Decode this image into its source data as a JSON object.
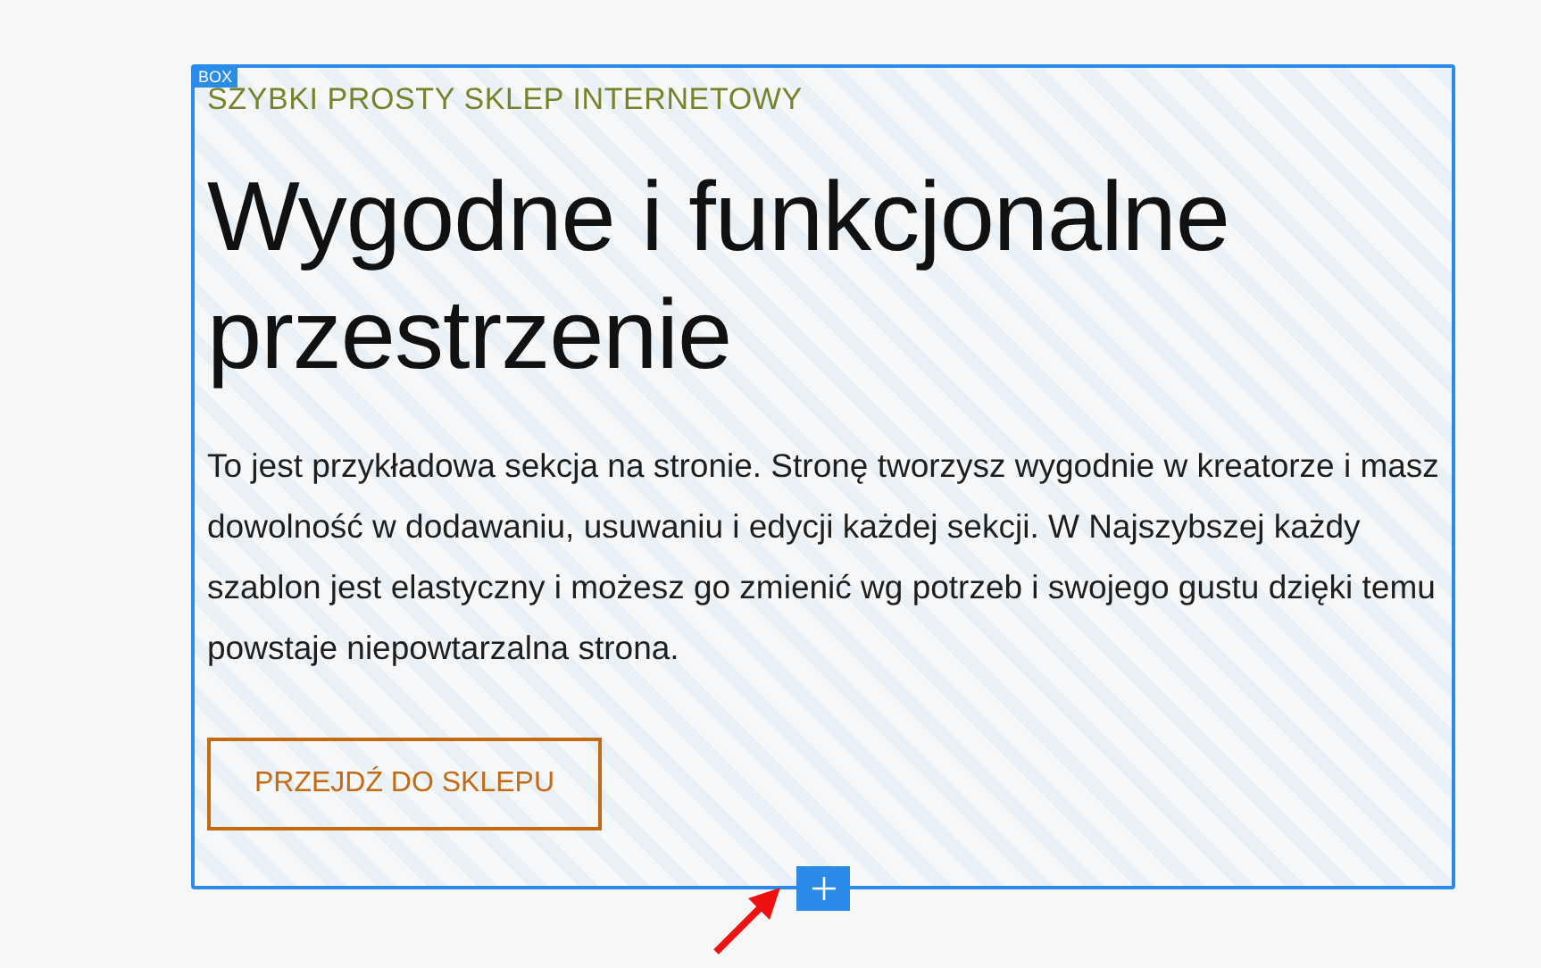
{
  "box": {
    "badge": "BOX",
    "eyebrow": "SZYBKI PROSTY SKLEP INTERNETOWY",
    "heading": "Wygodne i funkcjonalne przestrzenie",
    "paragraph": "To jest przykładowa sekcja na stronie. Stronę tworzysz wygodnie w kreatorze i masz dowolność w dodawaniu, usuwaniu i edycji każdej sekcji. W Najszybszej każdy szablon jest elastyczny i możesz go zmienić wg potrzeb i swojego gustu dzięki temu powstaje niepowtarzalna strona.",
    "button": "PRZEJDŹ DO SKLEPU"
  }
}
